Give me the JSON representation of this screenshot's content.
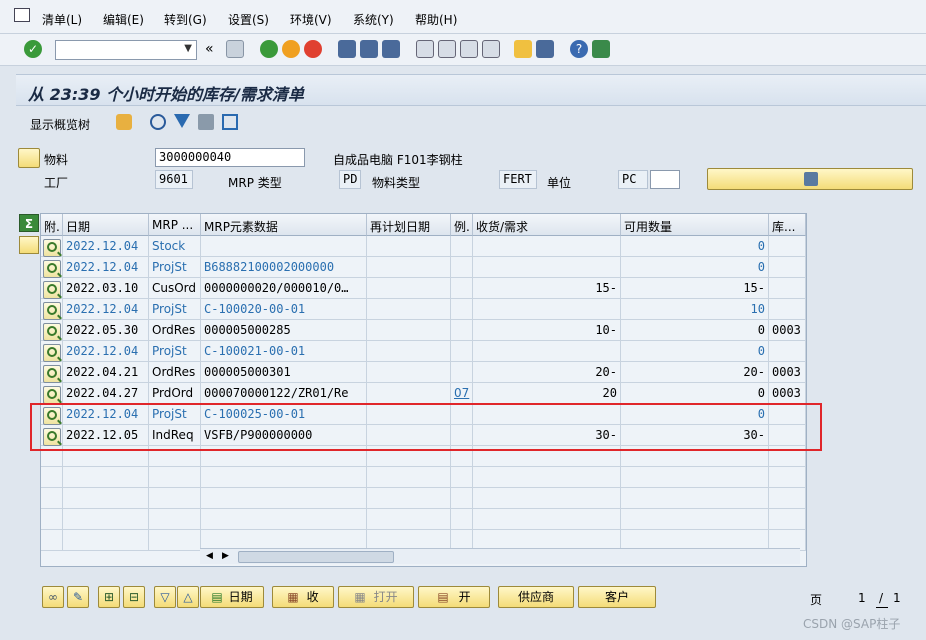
{
  "menu": [
    "清单(L)",
    "编辑(E)",
    "转到(G)",
    "设置(S)",
    "环境(V)",
    "系统(Y)",
    "帮助(H)"
  ],
  "toolbar": {
    "command_value": "",
    "back_symbol": "«"
  },
  "header": {
    "title": "从 23:39 个小时开始的库存/需求清单",
    "overview_tree": "显示概览树"
  },
  "material": {
    "material_label": "物料",
    "material_value": "3000000040",
    "material_desc": "自成品电脑 F101李钢柱",
    "plant_label": "工厂",
    "plant_value": "9601",
    "mrp_type_label": "MRP 类型",
    "mrp_type_value": "PD",
    "material_type_label": "物料类型",
    "material_type_value": "FERT",
    "unit_label": "单位",
    "unit_value": "PC"
  },
  "table": {
    "columns": [
      "附.",
      "日期",
      "MRP ...",
      "MRP元素数据",
      "再计划日期",
      "例.",
      "收货/需求",
      "可用数量",
      "库..."
    ],
    "rows": [
      {
        "date": "2022.12.04",
        "mrp": "Stock",
        "data": "",
        "resched": "",
        "ex": "",
        "recv": "",
        "avail": "0",
        "stor": "",
        "blue": true
      },
      {
        "date": "2022.12.04",
        "mrp": "ProjSt",
        "data": "B68882100002000000",
        "resched": "",
        "ex": "",
        "recv": "",
        "avail": "0",
        "stor": "",
        "blue": true
      },
      {
        "date": "2022.03.10",
        "mrp": "CusOrd",
        "data": "0000000020/000010/0…",
        "resched": "",
        "ex": "",
        "recv": "15-",
        "avail": "15-",
        "stor": "",
        "blue": false
      },
      {
        "date": "2022.12.04",
        "mrp": "ProjSt",
        "data": "C-100020-00-01",
        "resched": "",
        "ex": "",
        "recv": "",
        "avail": "10",
        "stor": "",
        "blue": true
      },
      {
        "date": "2022.05.30",
        "mrp": "OrdRes",
        "data": "000005000285",
        "resched": "",
        "ex": "",
        "recv": "10-",
        "avail": "0",
        "stor": "0003",
        "blue": false
      },
      {
        "date": "2022.12.04",
        "mrp": "ProjSt",
        "data": "C-100021-00-01",
        "resched": "",
        "ex": "",
        "recv": "",
        "avail": "0",
        "stor": "",
        "blue": true
      },
      {
        "date": "2022.04.21",
        "mrp": "OrdRes",
        "data": "000005000301",
        "resched": "",
        "ex": "",
        "recv": "20-",
        "avail": "20-",
        "stor": "0003",
        "blue": false
      },
      {
        "date": "2022.04.27",
        "mrp": "PrdOrd",
        "data": "000070000122/ZR01/Re",
        "resched": "",
        "ex": "07",
        "recv": "20",
        "avail": "0",
        "stor": "0003",
        "blue": false
      },
      {
        "date": "2022.12.04",
        "mrp": "ProjSt",
        "data": "C-100025-00-01",
        "resched": "",
        "ex": "",
        "recv": "",
        "avail": "0",
        "stor": "",
        "blue": true
      },
      {
        "date": "2022.12.05",
        "mrp": "IndReq",
        "data": "VSFB/P900000000",
        "resched": "",
        "ex": "",
        "recv": "30-",
        "avail": "30-",
        "stor": "",
        "blue": false
      }
    ]
  },
  "bottom": {
    "date_btn": "日期",
    "receipt_btn": "收",
    "open_btn": "打开",
    "open2_btn": "开",
    "vendor_btn": "供应商",
    "customer_btn": "客户",
    "page_label": "页",
    "page_current": "1",
    "page_sep": "/",
    "page_total": "1"
  },
  "watermark": "CSDN @SAP柱子"
}
